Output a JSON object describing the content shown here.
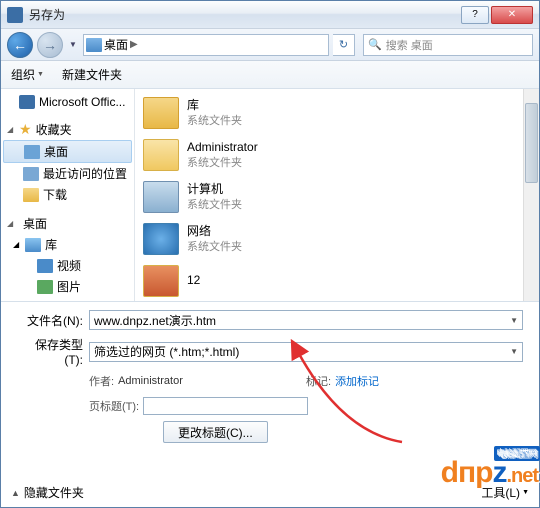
{
  "title": "另存为",
  "nav": {
    "location": "桌面",
    "search_placeholder": "搜索 桌面"
  },
  "toolbar": {
    "organize": "组织",
    "newfolder": "新建文件夹"
  },
  "sidebar": {
    "office": "Microsoft Offic...",
    "fav": "收藏夹",
    "fav_items": [
      "桌面",
      "最近访问的位置",
      "下载"
    ],
    "desktop": "桌面",
    "libs": "库",
    "lib_items": [
      "视频",
      "图片"
    ]
  },
  "files": [
    {
      "name": "库",
      "sub": "系统文件夹"
    },
    {
      "name": "Administrator",
      "sub": "系统文件夹"
    },
    {
      "name": "计算机",
      "sub": "系统文件夹"
    },
    {
      "name": "网络",
      "sub": "系统文件夹"
    },
    {
      "name": "12",
      "sub": ""
    }
  ],
  "form": {
    "filename_label": "文件名(N):",
    "filename_value": "www.dnpz.net演示.htm",
    "type_label": "保存类型(T):",
    "type_value": "筛选过的网页 (*.htm;*.html)",
    "author_label": "作者:",
    "author_value": "Administrator",
    "tags_label": "标记:",
    "tags_value": "添加标记",
    "pagetitle_label": "页标题(T):",
    "changetitle_btn": "更改标题(C)..."
  },
  "footer": {
    "hide": "隐藏文件夹",
    "tools": "工具(L)"
  },
  "watermark": {
    "text1": "dпр",
    "text2": "z",
    "text3": ".net",
    "tag": "电脑配置网"
  }
}
